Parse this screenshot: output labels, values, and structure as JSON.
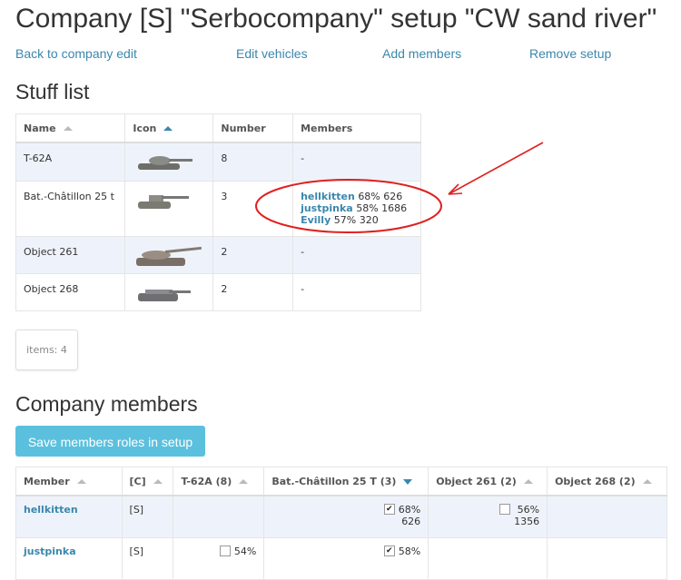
{
  "title": "Company [S] \"Serbocompany\" setup \"CW sand river\"",
  "nav": {
    "back": "Back to company edit",
    "edit_vehicles": "Edit vehicles",
    "add_members": "Add members",
    "remove_setup": "Remove setup"
  },
  "stuff": {
    "heading": "Stuff list",
    "columns": [
      "Name",
      "Icon",
      "Number",
      "Members"
    ],
    "rows": [
      {
        "name": "T-62A",
        "number": "8",
        "members_text": "-"
      },
      {
        "name": "Bat.-Châtillon 25 t",
        "number": "3",
        "members": [
          {
            "name": "hellkitten",
            "stats": "68% 626"
          },
          {
            "name": "justpinka",
            "stats": "58% 1686"
          },
          {
            "name": "Evilly",
            "stats": "57% 320"
          }
        ]
      },
      {
        "name": "Object 261",
        "number": "2",
        "members_text": "-"
      },
      {
        "name": "Object 268",
        "number": "2",
        "members_text": "-"
      }
    ],
    "items_count": "items: 4"
  },
  "company_members": {
    "heading": "Company members",
    "save_button": "Save members roles in setup",
    "columns": [
      "Member",
      "[C]",
      "T-62A (8)",
      "Bat.-Châtillon 25 T (3)",
      "Object 261 (2)",
      "Object 268 (2)"
    ],
    "rows": [
      {
        "member": "hellkitten",
        "tag": "[S]",
        "bat_checked": true,
        "bat_pct": "68%",
        "bat_battles": "626",
        "obj261_checked": false,
        "obj261_pct": "56%",
        "obj261_battles": "1356"
      },
      {
        "member": "justpinka",
        "tag": "[S]",
        "t62_checked": false,
        "t62_pct": "54%",
        "bat_checked": true,
        "bat_pct": "58%"
      }
    ]
  },
  "colors": {
    "link": "#3a87ad",
    "button": "#5bc0de",
    "annotation": "#e02020",
    "row_alt": "#eef3fb"
  }
}
